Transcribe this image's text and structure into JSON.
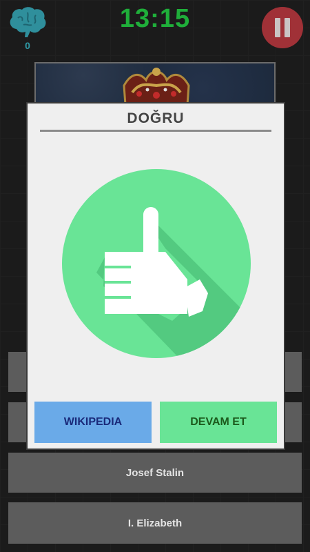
{
  "header": {
    "score": "0",
    "timer": "13:15"
  },
  "answers": [
    {
      "label": ""
    },
    {
      "label": ""
    },
    {
      "label": "Josef Stalin"
    },
    {
      "label": "I. Elizabeth"
    }
  ],
  "dialog": {
    "title": "DOĞRU",
    "wikipedia_label": "WIKIPEDIA",
    "continue_label": "DEVAM ET"
  },
  "colors": {
    "timer": "#1fae3a",
    "pause_button": "#b8353c",
    "correct_circle": "#69e496",
    "wiki_button": "#6aaae8",
    "continue_button": "#69e496"
  },
  "icons": {
    "brain": "brain-icon",
    "pause": "pause-icon",
    "result": "thumbs-up-icon"
  }
}
